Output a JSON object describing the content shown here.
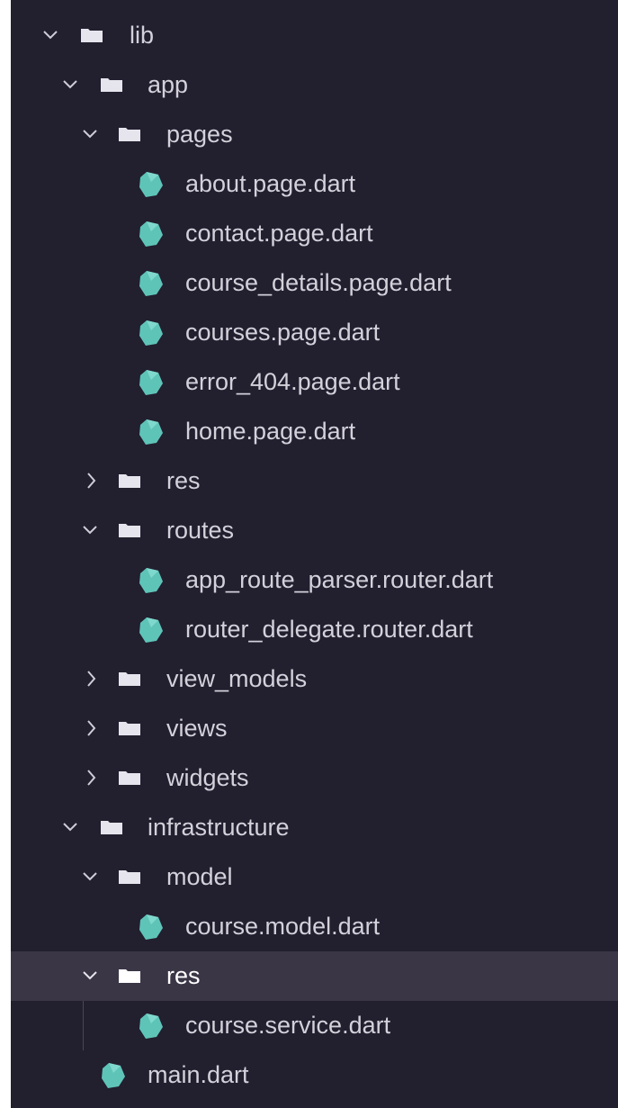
{
  "explorer": {
    "items": [
      {
        "label": "lib",
        "kind": "folder",
        "expanded": true
      },
      {
        "label": "app",
        "kind": "folder",
        "expanded": true
      },
      {
        "label": "pages",
        "kind": "folder",
        "expanded": true
      },
      {
        "label": "about.page.dart",
        "kind": "file",
        "icon": "dart-file-icon"
      },
      {
        "label": "contact.page.dart",
        "kind": "file",
        "icon": "dart-file-icon"
      },
      {
        "label": "course_details.page.dart",
        "kind": "file",
        "icon": "dart-file-icon"
      },
      {
        "label": "courses.page.dart",
        "kind": "file",
        "icon": "dart-file-icon"
      },
      {
        "label": "error_404.page.dart",
        "kind": "file",
        "icon": "dart-file-icon"
      },
      {
        "label": "home.page.dart",
        "kind": "file",
        "icon": "dart-file-icon"
      },
      {
        "label": "res",
        "kind": "folder",
        "expanded": false
      },
      {
        "label": "routes",
        "kind": "folder",
        "expanded": true
      },
      {
        "label": "app_route_parser.router.dart",
        "kind": "file",
        "icon": "dart-file-icon"
      },
      {
        "label": "router_delegate.router.dart",
        "kind": "file",
        "icon": "dart-file-icon"
      },
      {
        "label": "view_models",
        "kind": "folder",
        "expanded": false
      },
      {
        "label": "views",
        "kind": "folder",
        "expanded": false
      },
      {
        "label": "widgets",
        "kind": "folder",
        "expanded": false
      },
      {
        "label": "infrastructure",
        "kind": "folder",
        "expanded": true
      },
      {
        "label": "model",
        "kind": "folder",
        "expanded": true
      },
      {
        "label": "course.model.dart",
        "kind": "file",
        "icon": "dart-file-icon"
      },
      {
        "label": "res",
        "kind": "folder",
        "expanded": true,
        "selected": true
      },
      {
        "label": "course.service.dart",
        "kind": "file",
        "icon": "dart-file-icon"
      },
      {
        "label": "main.dart",
        "kind": "file",
        "icon": "dart-file-icon"
      }
    ]
  },
  "colors": {
    "background": "#221f2f",
    "selected_row": "#3a3646",
    "text": "#d3d1da",
    "folder_icon": "#e6e4ec",
    "dart_icon": "#5fc4b8"
  }
}
